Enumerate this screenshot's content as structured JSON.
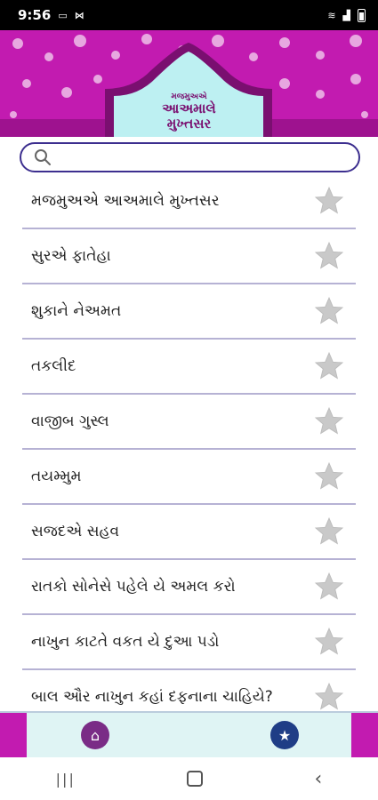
{
  "status": {
    "time": "9:56"
  },
  "banner": {
    "line1": "મજમુઅએ",
    "line2": "આઅમાલે",
    "line3": "મુખ્તસર"
  },
  "search": {
    "placeholder": ""
  },
  "items": [
    {
      "label": "મજમુઅએ આઅમાલે મુખ્તસર"
    },
    {
      "label": "સુરએ ફાતેહા"
    },
    {
      "label": "શુકાને નેઅમત"
    },
    {
      "label": "તકલીદ"
    },
    {
      "label": "વાજીબ ગુસ્લ"
    },
    {
      "label": "તયમ્મુમ"
    },
    {
      "label": "સજદએ સહવ"
    },
    {
      "label": "રાતકો સોનેસે પહેલે યે અમલ કરો"
    },
    {
      "label": "નાખુન કાટતે વકત યે દુઆ પડો"
    },
    {
      "label": "બાલ ઔર નાખુન કહાં દફનાના ચાહિયે?"
    }
  ],
  "bottom_nav": {
    "home_icon": "home-icon",
    "favorites_icon": "star-icon"
  },
  "colors": {
    "banner": "#c21bb0",
    "search_border": "#3d2f8f",
    "divider": "#b6b2d4",
    "star": "#c9c9c9"
  }
}
